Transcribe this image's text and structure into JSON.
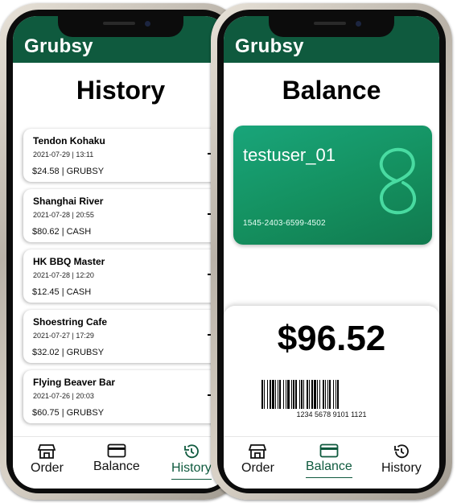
{
  "app": {
    "brand": "Grubsy"
  },
  "history_screen": {
    "title": "History",
    "orders": [
      {
        "restaurant": "Tendon Kohaku",
        "datetime": "2021-07-29 | 13:11",
        "payment": "$24.58 | GRUBSY"
      },
      {
        "restaurant": "Shanghai River",
        "datetime": "2021-07-28 | 20:55",
        "payment": "$80.62 | CASH"
      },
      {
        "restaurant": "HK BBQ Master",
        "datetime": "2021-07-28 | 12:20",
        "payment": "$12.45 | CASH"
      },
      {
        "restaurant": "Shoestring Cafe",
        "datetime": "2021-07-27 | 17:29",
        "payment": "$32.02 | GRUBSY"
      },
      {
        "restaurant": "Flying Beaver Bar",
        "datetime": "2021-07-26 | 20:03",
        "payment": "$60.75 | GRUBSY"
      }
    ],
    "active_tab": "History"
  },
  "balance_screen": {
    "title": "Balance",
    "card": {
      "username": "testuser_01",
      "number": "1545-2403-6599-4502"
    },
    "balance": "$96.52",
    "barcode_number": "1234 5678 9101 1121",
    "active_tab": "Balance"
  },
  "tabs": {
    "order": "Order",
    "balance": "Balance",
    "history": "History"
  },
  "colors": {
    "brand_green": "#0f5a3e",
    "card_green": "#14905f"
  },
  "icons": {
    "order": "store-icon",
    "balance": "card-icon",
    "history": "history-icon",
    "arrow": "arrow-right-icon"
  }
}
